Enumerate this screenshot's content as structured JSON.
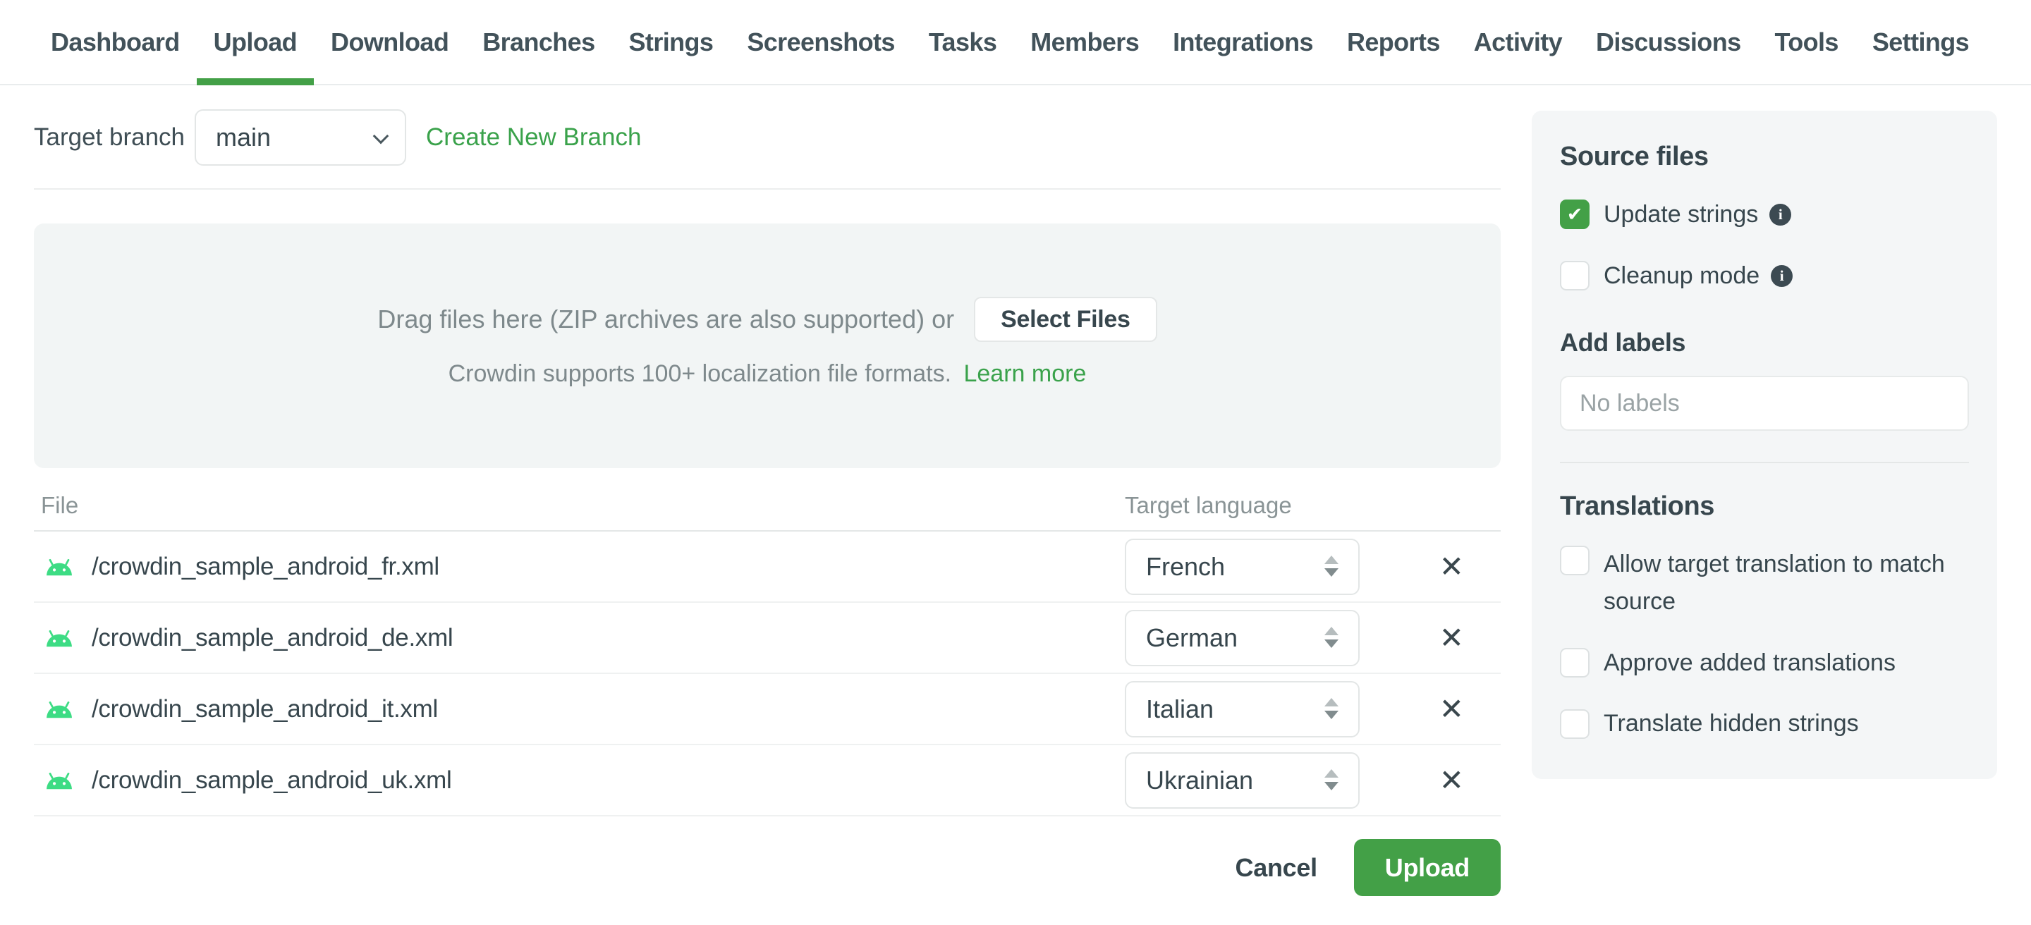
{
  "colors": {
    "accent_green": "#43a047",
    "link_green": "#3aa24b",
    "android_icon_green": "#3ddc84",
    "text_dark": "#37464d",
    "muted_gray": "#8a9496",
    "panel_gray": "#f4f6f7"
  },
  "nav": {
    "items": [
      "Dashboard",
      "Upload",
      "Download",
      "Branches",
      "Strings",
      "Screenshots",
      "Tasks",
      "Members",
      "Integrations",
      "Reports",
      "Activity",
      "Discussions",
      "Tools",
      "Settings"
    ],
    "active": "Upload"
  },
  "branch": {
    "label": "Target branch",
    "selected": "main",
    "create_link": "Create New Branch"
  },
  "dropzone": {
    "drag_text": "Drag files here (ZIP archives are also supported) or",
    "select_button": "Select Files",
    "formats_text": "Crowdin supports 100+ localization file formats.",
    "learn_more": "Learn more"
  },
  "table": {
    "file_header": "File",
    "language_header": "Target language",
    "rows": [
      {
        "file": "/crowdin_sample_android_fr.xml",
        "language": "French"
      },
      {
        "file": "/crowdin_sample_android_de.xml",
        "language": "German"
      },
      {
        "file": "/crowdin_sample_android_it.xml",
        "language": "Italian"
      },
      {
        "file": "/crowdin_sample_android_uk.xml",
        "language": "Ukrainian"
      }
    ],
    "remove_glyph": "✕"
  },
  "sidebar": {
    "source_files": {
      "title": "Source files",
      "update_strings": {
        "label": "Update strings",
        "checked": true,
        "check_glyph": "✔"
      },
      "cleanup_mode": {
        "label": "Cleanup mode",
        "checked": false
      }
    },
    "add_labels": {
      "title": "Add labels",
      "placeholder": "No labels"
    },
    "translations": {
      "title": "Translations",
      "options": [
        {
          "label": "Allow target translation to match source",
          "checked": false
        },
        {
          "label": "Approve added translations",
          "checked": false
        },
        {
          "label": "Translate hidden strings",
          "checked": false
        }
      ]
    },
    "info_glyph": "i"
  },
  "footer": {
    "cancel": "Cancel",
    "upload": "Upload"
  }
}
